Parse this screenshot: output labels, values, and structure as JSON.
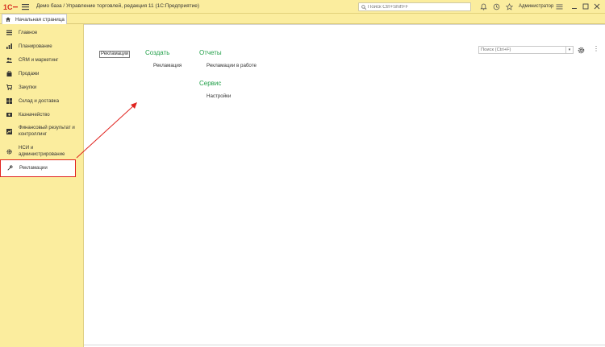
{
  "window": {
    "title": "Демо база / Управление торговлей, редакция 11  (1С:Предприятие)",
    "search_placeholder": "Поиск Ctrl+Shift+F",
    "user": "Администратор"
  },
  "tabs": {
    "home_label": "Начальная страница"
  },
  "sidebar": {
    "items": [
      {
        "label": "Главное",
        "icon": "list-icon"
      },
      {
        "label": "Планирование",
        "icon": "chart-icon"
      },
      {
        "label": "CRM и маркетинг",
        "icon": "crm-icon"
      },
      {
        "label": "Продажи",
        "icon": "bag-icon"
      },
      {
        "label": "Закупки",
        "icon": "cart-icon"
      },
      {
        "label": "Склад и доставка",
        "icon": "warehouse-icon"
      },
      {
        "label": "Казначейство",
        "icon": "money-icon"
      },
      {
        "label": "Финансовый результат и контроллинг",
        "icon": "finance-icon"
      },
      {
        "label": "НСИ и администрирование",
        "icon": "gear-icon"
      },
      {
        "label": "Рекламации",
        "icon": "wrench-icon"
      }
    ],
    "active_index": 9
  },
  "content": {
    "search_placeholder": "Поиск (Ctrl+F)",
    "section_button": "Рекламации",
    "create": {
      "heading": "Создать",
      "links": [
        "Рекламация"
      ]
    },
    "reports": {
      "heading": "Отчеты",
      "links": [
        "Рекламации в работе"
      ]
    },
    "service": {
      "heading": "Сервис",
      "links": [
        "Настройки"
      ]
    }
  },
  "colors": {
    "header_bg": "#fbed9e",
    "heading_green": "#23a04a",
    "highlight_red": "#e0231f"
  }
}
